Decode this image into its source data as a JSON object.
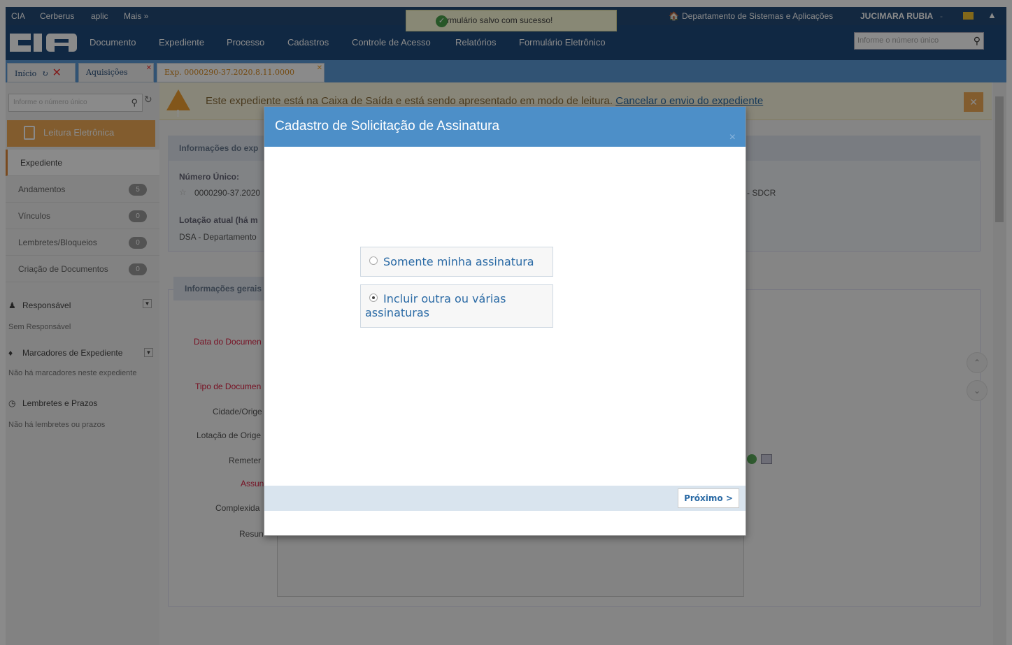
{
  "topbar": {
    "links": [
      "CIA",
      "Cerberus",
      "aplic",
      "Mais »"
    ],
    "department": "Departamento de Sistemas e Aplicações",
    "user": "JUCIMARA RUBIA"
  },
  "toast": {
    "message": "Formulário salvo com sucesso!"
  },
  "navbar": {
    "logo": "CIA",
    "items": [
      "Documento",
      "Expediente",
      "Processo",
      "Cadastros",
      "Controle de Acesso",
      "Relatórios",
      "Formulário Eletrônico"
    ],
    "search_placeholder": "Informe o número único"
  },
  "tabs": [
    {
      "label": "Início"
    },
    {
      "label": "Aquisições"
    },
    {
      "label": "Exp. 0000290-37.2020.8.11.0000"
    }
  ],
  "sidebar": {
    "search_placeholder": "Informe o número único",
    "leitura_label": "Leitura Eletrônica",
    "menu": [
      {
        "label": "Expediente"
      },
      {
        "label": "Andamentos",
        "count": "5"
      },
      {
        "label": "Vínculos",
        "count": "0"
      },
      {
        "label": "Lembretes/Bloqueios",
        "count": "0"
      },
      {
        "label": "Criação de Documentos",
        "count": "0"
      }
    ],
    "responsavel_label": "Responsável",
    "responsavel_value": "Sem Responsável",
    "marcadores_label": "Marcadores de Expediente",
    "marcadores_value": "Não há marcadores neste expediente",
    "lembretes_label": "Lembretes e Prazos",
    "lembretes_value": "Não há lembretes ou prazos"
  },
  "warning": {
    "text": "Este expediente está na Caixa de Saída e está sendo apresentado em modo de leitura.",
    "link": "Cancelar o envio do expediente"
  },
  "info": {
    "header": "Informações do exp",
    "numero_label": "Número Único:",
    "numero_value": "0000290-37.2020",
    "lotacao_label": "Lotação atual (há m",
    "lotacao_value": "DSA - Departamento",
    "right_value": "- SDCR"
  },
  "gerais": {
    "header": "Informações gerais",
    "fields": [
      "Data do Documen",
      "Tipo de Documen",
      "Cidade/Orige",
      "Lotação de Orige",
      "Remeter",
      "Assun",
      "Complexida",
      "Resun"
    ]
  },
  "modal": {
    "title": "Cadastro de Solicitação de Assinatura",
    "close": "×",
    "options": [
      {
        "label": "Somente minha assinatura",
        "selected": false
      },
      {
        "label": "Incluir outra ou várias assinaturas",
        "selected": true
      }
    ],
    "next_label": "Próximo >"
  }
}
